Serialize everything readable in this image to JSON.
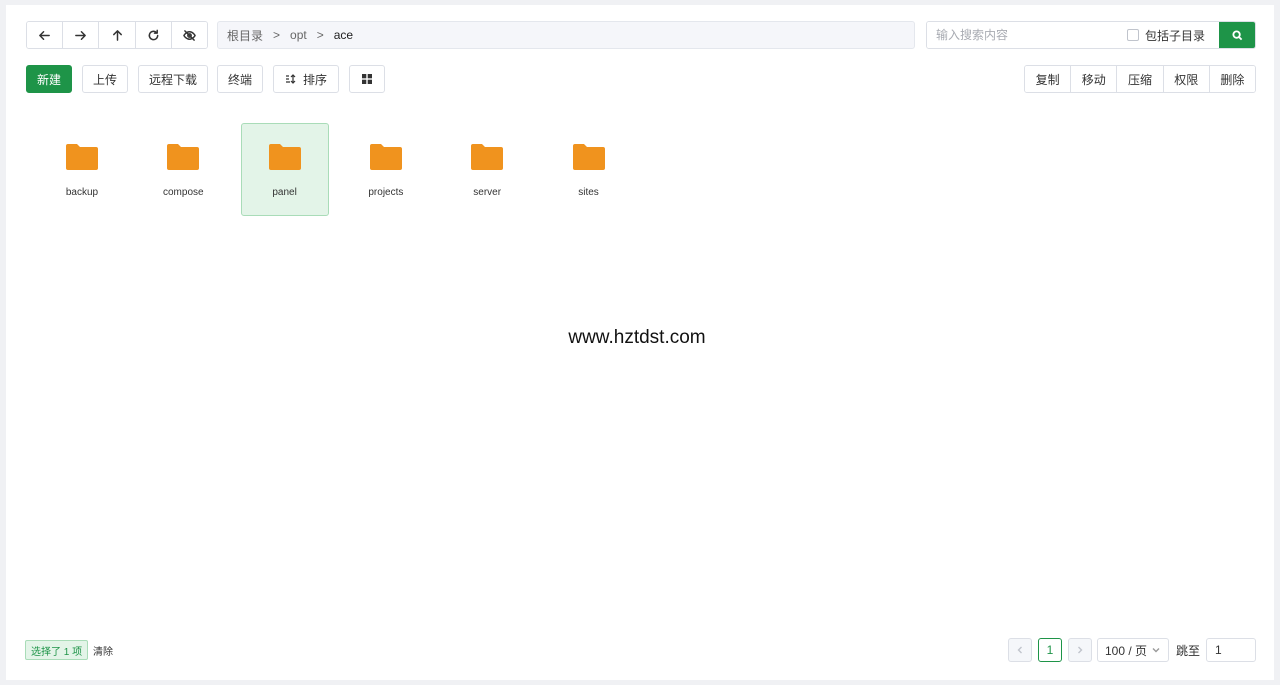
{
  "nav": {
    "back": "arrow-left-icon",
    "forward": "arrow-right-icon",
    "up": "arrow-up-icon",
    "refresh": "refresh-icon",
    "hidden": "eye-off-icon"
  },
  "breadcrumb": {
    "items": [
      "根目录",
      "opt",
      "ace"
    ],
    "separator": ">"
  },
  "search": {
    "placeholder": "输入搜索内容",
    "subdir_label": "包括子目录",
    "subdir_checked": false,
    "button_icon": "search-icon"
  },
  "toolbar": {
    "new_label": "新建",
    "upload_label": "上传",
    "remote_download_label": "远程下载",
    "terminal_label": "终端",
    "sort_label": "排序",
    "view_icon": "grid-icon"
  },
  "actions": {
    "copy": "复制",
    "move": "移动",
    "compress": "压缩",
    "permission": "权限",
    "delete": "删除"
  },
  "folders": [
    {
      "name": "backup",
      "selected": false
    },
    {
      "name": "compose",
      "selected": false
    },
    {
      "name": "panel",
      "selected": true
    },
    {
      "name": "projects",
      "selected": false
    },
    {
      "name": "server",
      "selected": false
    },
    {
      "name": "sites",
      "selected": false
    }
  ],
  "watermark": "www.hztdst.com",
  "footer": {
    "selected_text": "选择了 1 项",
    "clear_label": "清除",
    "current_page": "1",
    "page_size": "100 / 页",
    "goto_label": "跳至",
    "goto_value": "1"
  },
  "colors": {
    "primary": "#1e9448",
    "folder": "#f0931e",
    "selected_bg": "#e3f4e8"
  }
}
